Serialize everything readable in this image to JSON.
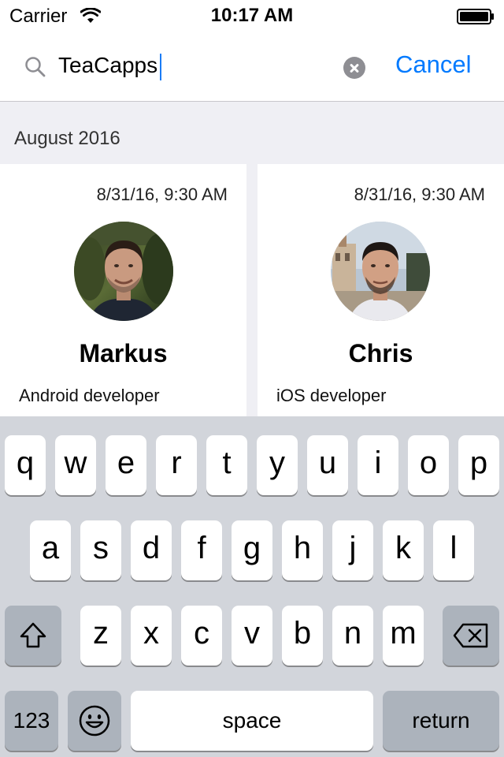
{
  "status_bar": {
    "carrier": "Carrier",
    "time": "10:17 AM"
  },
  "search": {
    "query": "TeaCapps",
    "cancel_label": "Cancel"
  },
  "section_header": "August 2016",
  "cards": [
    {
      "date": "8/31/16, 9:30 AM",
      "name": "Markus",
      "role": "Android developer"
    },
    {
      "date": "8/31/16, 9:30 AM",
      "name": "Chris",
      "role": "iOS developer"
    }
  ],
  "keyboard": {
    "row1": [
      "q",
      "w",
      "e",
      "r",
      "t",
      "y",
      "u",
      "i",
      "o",
      "p"
    ],
    "row2": [
      "a",
      "s",
      "d",
      "f",
      "g",
      "h",
      "j",
      "k",
      "l"
    ],
    "row3": [
      "z",
      "x",
      "c",
      "v",
      "b",
      "n",
      "m"
    ],
    "numbers_label": "123",
    "space_label": "space",
    "return_label": "return",
    "icons": {
      "shift": "shift-icon",
      "delete": "delete-icon",
      "emoji": "emoji-icon"
    }
  },
  "colors": {
    "accent": "#007aff",
    "background": "#efeff4",
    "keyboard": "#d2d5db"
  }
}
